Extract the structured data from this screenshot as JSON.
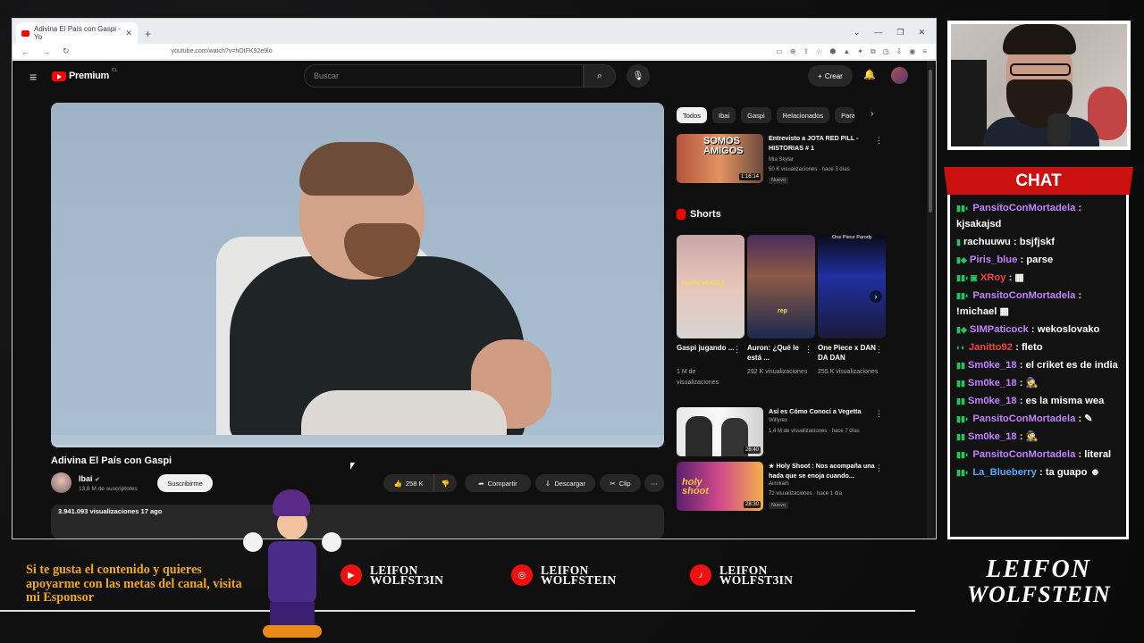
{
  "browser": {
    "tab_title": "Adivina El País con Gaspi - Yo",
    "url": "youtube.com/watch?v=hOIFK92e9lo"
  },
  "youtube": {
    "logo_text": "Premium",
    "logo_region": "CL",
    "search_placeholder": "Buscar",
    "create_label": "Crear",
    "video": {
      "title": "Adivina El País con Gaspi",
      "progress_fraction": 0.0,
      "channel": "Ibai",
      "subscribers": "13,8 M de suscriptores",
      "subscribe_label": "Suscribirme",
      "likes": "258 K",
      "share_label": "Compartir",
      "download_label": "Descargar",
      "clip_label": "Clip",
      "views_date": "3.941.093 visualizaciones  17 ago"
    },
    "chips": [
      "Todos",
      "Ibai",
      "Gaspi",
      "Relacionados",
      "Para"
    ],
    "recs": [
      {
        "title": "Entrevisto a JOTA RED PILL - HISTORIAS # 1",
        "channel": "Mia Skylar",
        "meta": "50 K visualizaciones · hace 3 días",
        "badge": "Nuevo",
        "duration": "1:16:14",
        "thumb_text": "SOMOS AMIGOS"
      },
      {
        "title": "Así es Cómo Conocí a Vegetta",
        "channel": "Willyrex",
        "meta": "1,4 M de visualizaciones · hace 7 días",
        "badge": "",
        "duration": "26:40",
        "thumb_text": ""
      },
      {
        "title": "★ Holy Shoot : Nos acompaña una hada que se enoja cuando...",
        "channel": "Aimikaih",
        "meta": "72 visualizaciones · hace 1 día",
        "badge": "Nuevo",
        "duration": "28:30",
        "thumb_text": "holy shoot"
      }
    ],
    "shorts_header": "Shorts",
    "shorts": [
      {
        "title": "Gaspi jugando ...",
        "views": "1 M de visualizaciones",
        "overlay": "HAPPY WHEELS"
      },
      {
        "title": "Auron: ¿Qué le está ...",
        "views": "292 K visualizaciones",
        "overlay": "rep"
      },
      {
        "title": "One Piece x DAN DA DAN",
        "views": "255 K visualizaciones",
        "overlay": "One Piece Parody"
      }
    ]
  },
  "chat": {
    "header": "CHAT",
    "messages": [
      {
        "user": "PansitoConMortadela",
        "color": "#c084fc",
        "text": "kjsakajsd",
        "badges": "▮▮◐"
      },
      {
        "user": "rachuuwu",
        "color": "#ffffff",
        "text": "bsjfjskf",
        "badges": "▮"
      },
      {
        "user": "Piris_blue",
        "color": "#c084fc",
        "text": "parse",
        "badges": "▮◆"
      },
      {
        "user": "XRoy",
        "color": "#ef4444",
        "text": "▦",
        "badges": "▮▮◐▣"
      },
      {
        "user": "PansitoConMortadela",
        "color": "#c084fc",
        "text": "!michael ▦",
        "badges": "▮▮◐"
      },
      {
        "user": "SIMPaticock",
        "color": "#c084fc",
        "text": "wekoslovako",
        "badges": "▮◆"
      },
      {
        "user": "Janitto92",
        "color": "#ef4444",
        "text": "fleto",
        "badges": "◐◐"
      },
      {
        "user": "Sm0ke_18",
        "color": "#c084fc",
        "text": "el criket es de india",
        "badges": "▮▮"
      },
      {
        "user": "Sm0ke_18",
        "color": "#c084fc",
        "text": "🕵",
        "badges": "▮▮"
      },
      {
        "user": "Sm0ke_18",
        "color": "#c084fc",
        "text": "es la misma wea",
        "badges": "▮▮"
      },
      {
        "user": "PansitoConMortadela",
        "color": "#c084fc",
        "text": "✎",
        "badges": "▮▮◐"
      },
      {
        "user": "Sm0ke_18",
        "color": "#c084fc",
        "text": "🕵",
        "badges": "▮▮"
      },
      {
        "user": "PansitoConMortadela",
        "color": "#c084fc",
        "text": "literal",
        "badges": "▮▮◐"
      },
      {
        "user": "La_Blueberry",
        "color": "#60a5fa",
        "text": "ta guapo ☻",
        "badges": "▮▮◐"
      }
    ]
  },
  "overlay": {
    "promo_text": "Si te gusta el contenido y quieres apoyarme con las metas del canal, visita mi Esponsor",
    "socials": [
      {
        "platform": "youtube-icon",
        "line1": "LEIFON",
        "line2": "WOLFST3IN",
        "color": "#e11d1d"
      },
      {
        "platform": "instagram-icon",
        "line1": "LEIFON",
        "line2": "WOLFSTEIN",
        "color": "#e11d1d"
      },
      {
        "platform": "tiktok-icon",
        "line1": "LEIFON",
        "line2": "WOLFST3IN",
        "color": "#e11d1d"
      }
    ],
    "brand_line1": "LEIFON",
    "brand_line2": "WOLFSTEIN"
  }
}
